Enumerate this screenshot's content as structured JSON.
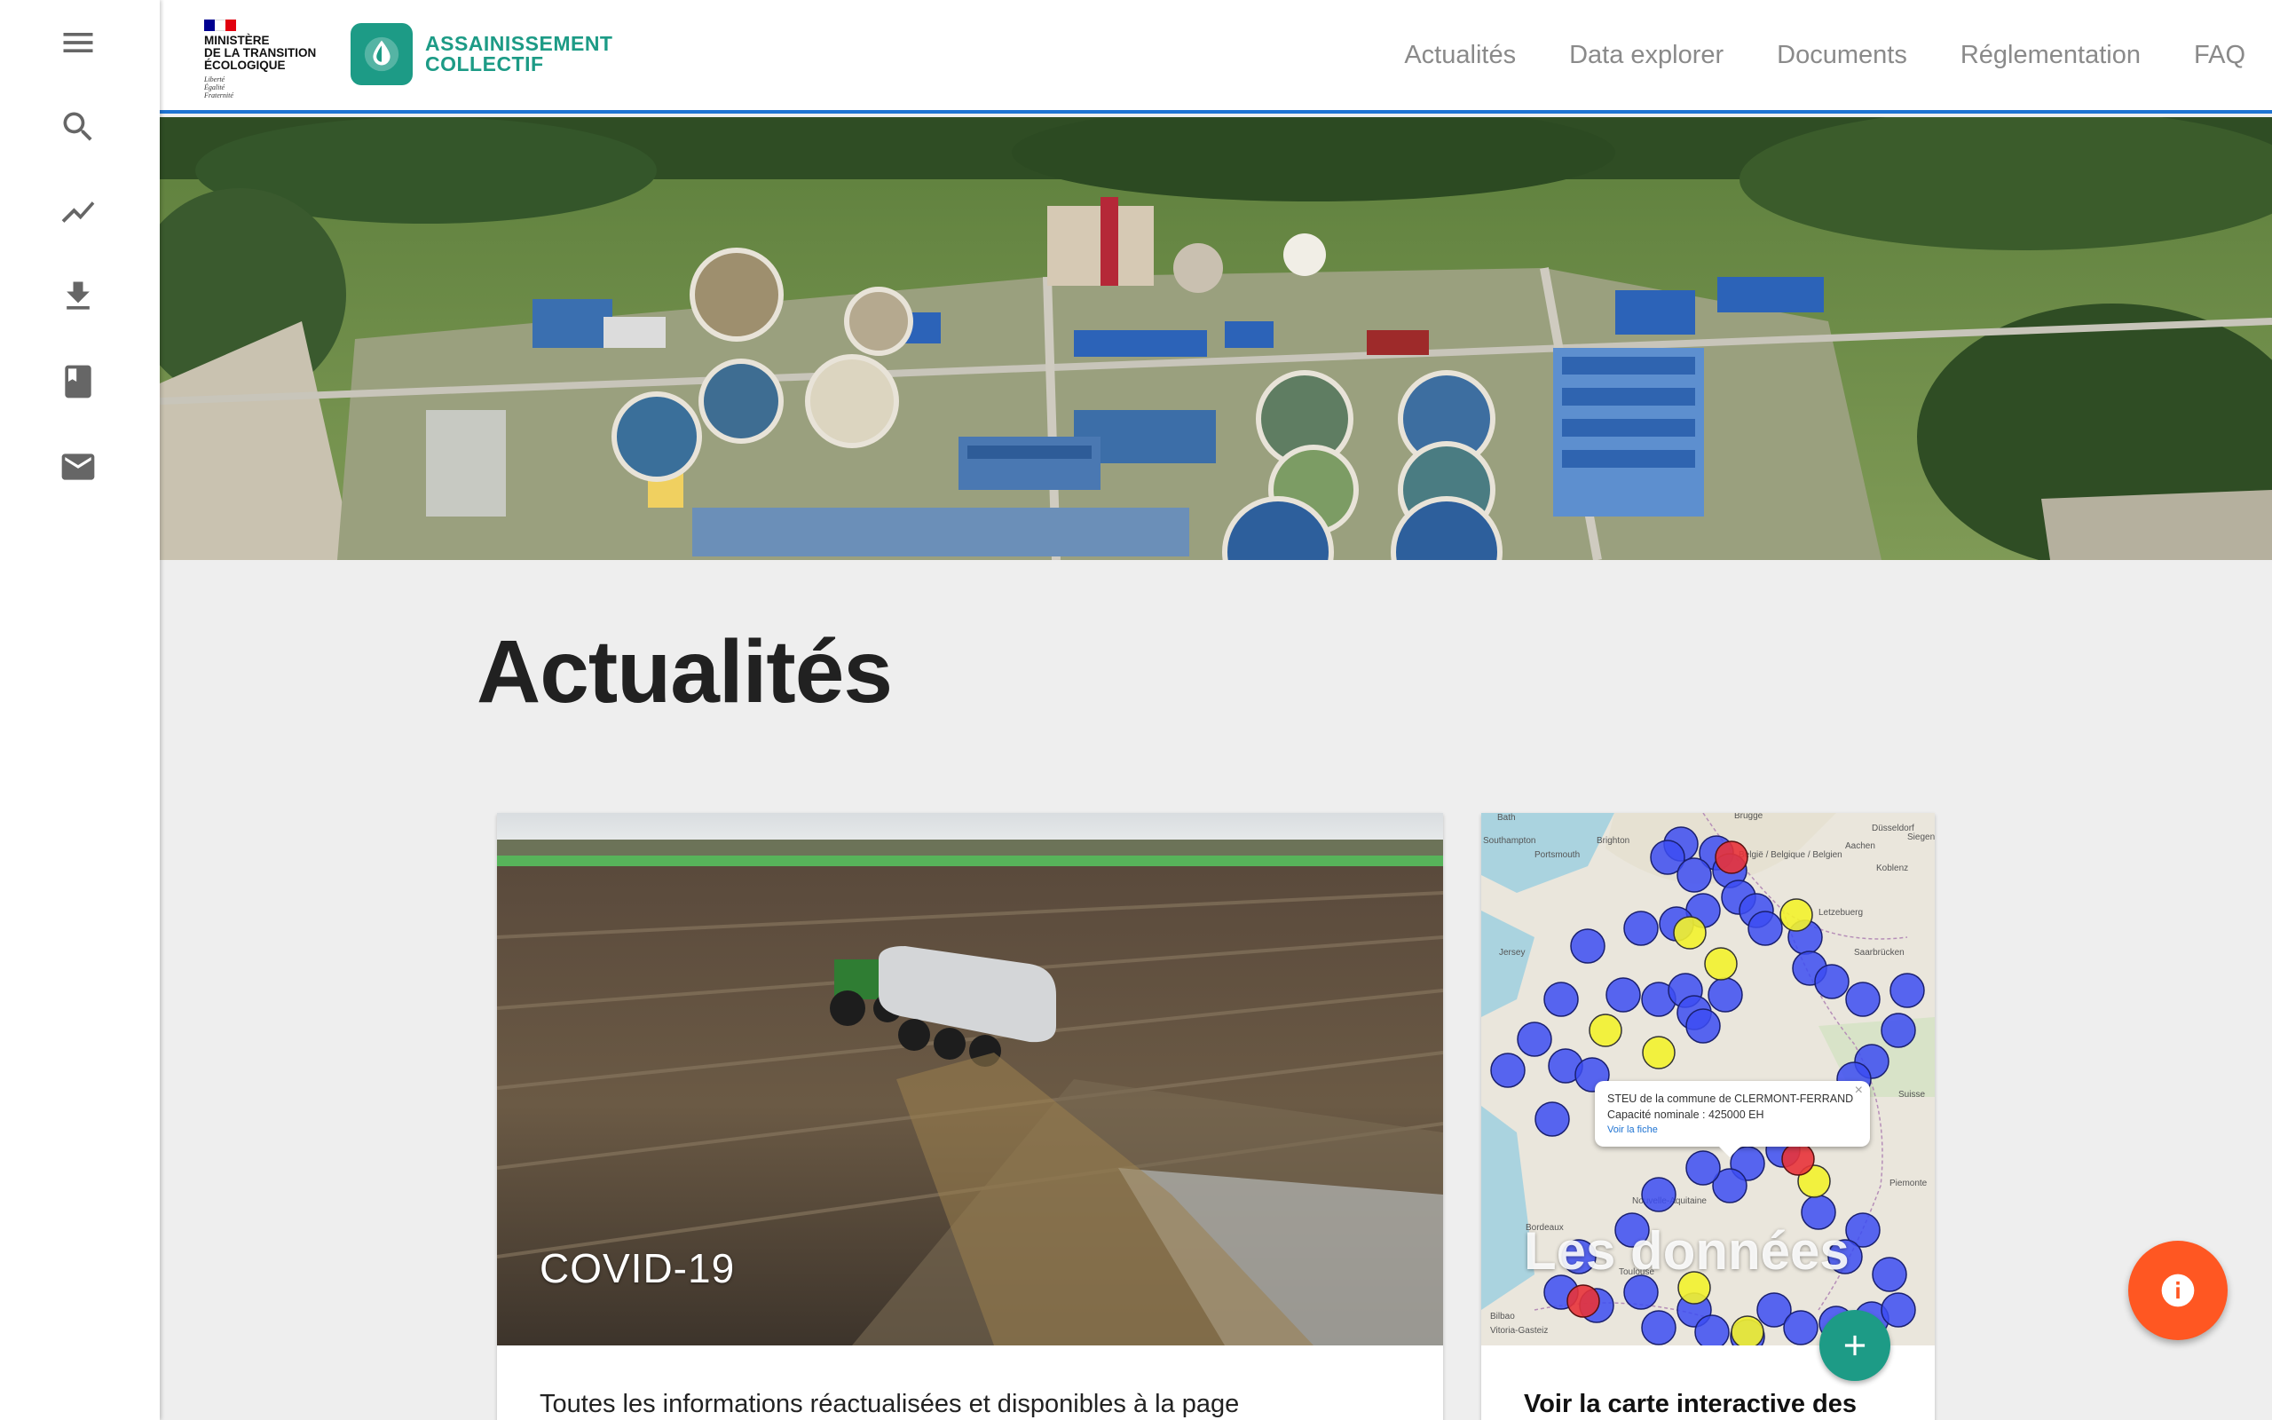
{
  "rail": {
    "items": [
      {
        "name": "menu-icon"
      },
      {
        "name": "search-icon"
      },
      {
        "name": "trending-icon"
      },
      {
        "name": "download-icon"
      },
      {
        "name": "book-icon"
      },
      {
        "name": "mail-icon"
      }
    ]
  },
  "header": {
    "gov": {
      "name_line1": "MINISTÈRE",
      "name_line2": "DE LA TRANSITION",
      "name_line3": "ÉCOLOGIQUE",
      "motto_line1": "Liberté",
      "motto_line2": "Égalité",
      "motto_line3": "Fraternité"
    },
    "brand": {
      "line1": "ASSAINISSEMENT",
      "line2": "COLLECTIF",
      "color": "#1d9b86"
    },
    "nav": [
      "Actualités",
      "Data explorer",
      "Documents",
      "Réglementation",
      "FAQ"
    ],
    "accent": "#1e73d2"
  },
  "main": {
    "title": "Actualités",
    "cards": [
      {
        "caption": "COVID-19",
        "text": "Toutes les informations réactualisées et disponibles à la page"
      },
      {
        "caption": "Les données",
        "text": "Voir la carte interactive des",
        "map_labels": [
          "Bath",
          "Brugge",
          "Southampton",
          "Brighton",
          "Portsmouth",
          "Düsseldorf",
          "Aachen",
          "Siegen",
          "Koblenz",
          "België / Belgique / Belgien",
          "Letzebuerg",
          "Saarbrücken",
          "Jersey",
          "Nouvelle-Aquitaine",
          "Bordeaux",
          "Toulouse",
          "Bilbao",
          "Vitoria-Gasteiz",
          "Suisse",
          "Piemonte"
        ],
        "popup": {
          "line1": "STEU de la commune de CLERMONT-FERRAND",
          "line2": "Capacité nominale : 425000 EH",
          "link": "Voir la fiche",
          "close": "×"
        }
      }
    ]
  },
  "fabs": {
    "add_color": "#1d9b86",
    "info_color": "#ff5722"
  }
}
